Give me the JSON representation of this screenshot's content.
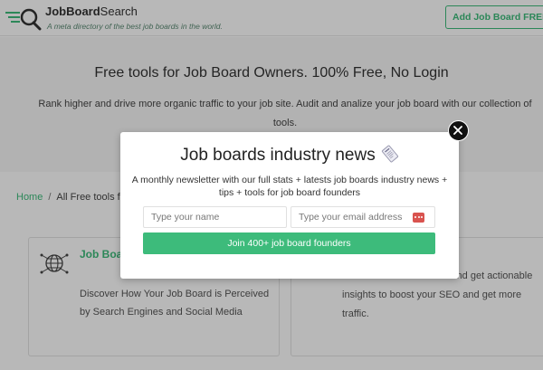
{
  "header": {
    "brand_bold": "JobBoard",
    "brand_light": "Search",
    "tagline": "A meta directory of the best job boards in the world.",
    "cta_label": "Add Job Board FREE"
  },
  "hero": {
    "title": "Free tools for Job Board Owners. 100% Free, No Login",
    "text": "Rank higher and drive more organic traffic to your job site. Audit and analize your job board with our collection of tools."
  },
  "breadcrumb": {
    "home": "Home",
    "separator": "/",
    "current": "All Free tools fo"
  },
  "cards": [
    {
      "title": "Job Boa Checke",
      "text": "Discover How Your Job Board is Perceived by Search Engines and Social Media"
    },
    {
      "text": "e to detect critical errors and get actionable insights to boost your SEO and get more traffic."
    }
  ],
  "modal": {
    "title": "Job boards industry news",
    "description": "A monthly newsletter with our full stats + latests job boards industry news + tips + tools for job board founders",
    "name_placeholder": "Type your name",
    "email_placeholder": "Type your email address",
    "submit_label": "Join 400+ job board founders"
  },
  "colors": {
    "accent": "#3dbb7b",
    "overlay": "rgba(0,0,0,0.28)"
  },
  "icons": {
    "logo": "magnifier-lines-icon",
    "card1": "globe-network-icon",
    "modal_title": "newspaper-icon",
    "password_manager": "password-dots-icon",
    "close": "close-icon"
  }
}
